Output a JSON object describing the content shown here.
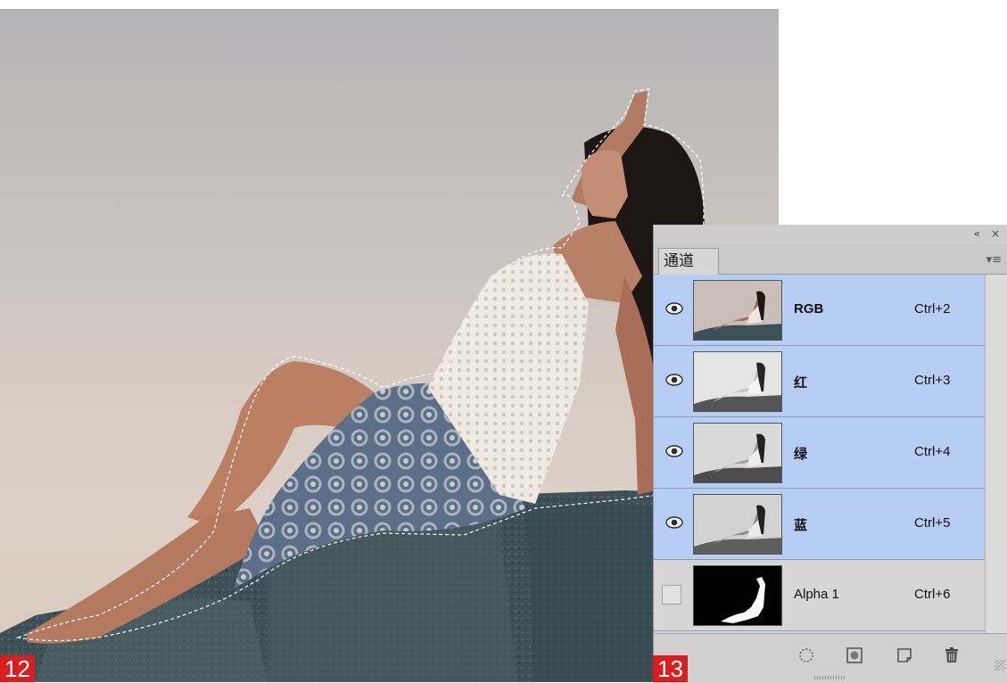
{
  "badges": {
    "left": "12",
    "right": "13"
  },
  "panel": {
    "collapse_icon": "double-chevron-left-icon",
    "close_icon": "close-icon",
    "tab_label": "通道",
    "menu_icon": "panel-menu-icon",
    "channels": [
      {
        "name": "RGB",
        "shortcut": "Ctrl+2",
        "visible": true,
        "selected": true
      },
      {
        "name": "红",
        "shortcut": "Ctrl+3",
        "visible": true,
        "selected": true
      },
      {
        "name": "绿",
        "shortcut": "Ctrl+4",
        "visible": true,
        "selected": true
      },
      {
        "name": "蓝",
        "shortcut": "Ctrl+5",
        "visible": true,
        "selected": true
      },
      {
        "name": "Alpha 1",
        "shortcut": "Ctrl+6",
        "visible": false,
        "selected": false
      }
    ],
    "bottom_icons": [
      "load-selection-icon",
      "save-selection-icon",
      "new-channel-icon",
      "trash-icon"
    ]
  },
  "colors": {
    "selection": "#b7cdf3",
    "badge": "#d81e1e",
    "panel": "#d6d6d6"
  }
}
